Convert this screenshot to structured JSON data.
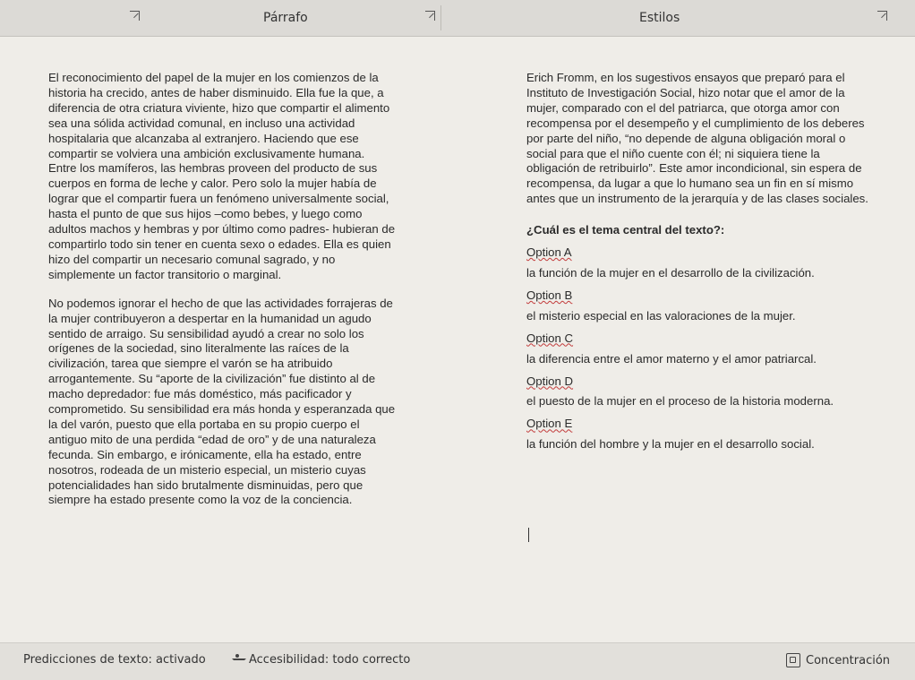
{
  "ribbon": {
    "group_paragraph": "Párrafo",
    "group_styles": "Estilos"
  },
  "document": {
    "left": {
      "para1": "El reconocimiento del papel de la mujer en los comienzos de la historia ha crecido, antes de haber disminuido. Ella fue la que, a diferencia de otra criatura viviente, hizo que compartir el alimento sea una sólida actividad comunal, en incluso una actividad hospitalaria que alcanzaba al extranjero. Haciendo que ese compartir se volviera una ambición exclusivamente humana. Entre los mamíferos, las hembras proveen del producto de sus cuerpos en forma de leche y calor. Pero solo la mujer había de lograr que el compartir fuera un fenómeno universalmente social, hasta el punto de que sus hijos –como bebes, y luego como adultos machos y hembras y por último como padres- hubieran de compartirlo todo sin tener en cuenta sexo o edades. Ella es quien hizo del compartir un necesario comunal sagrado, y no simplemente un factor transitorio o marginal.",
      "para2": "No podemos ignorar el hecho de que las actividades forrajeras de la mujer contribuyeron a despertar en la humanidad un agudo sentido de arraigo. Su sensibilidad ayudó a crear no solo los orígenes de la sociedad, sino literalmente las raíces de la civilización, tarea que siempre el varón se ha atribuido arrogantemente. Su “aporte de la civilización” fue distinto al de macho depredador: fue más doméstico, más pacificador y comprometido. Su sensibilidad era más honda y esperanzada que la del varón, puesto que ella portaba en su propio cuerpo el antiguo mito de una perdida “edad de oro” y de una naturaleza fecunda. Sin embargo, e irónicamente, ella ha estado, entre nosotros, rodeada de un misterio especial, un misterio cuyas potencialidades han sido brutalmente disminuidas, pero que siempre ha estado presente como la voz de la conciencia."
    },
    "right": {
      "para1": "Erich Fromm, en los sugestivos ensayos que preparó para el Instituto de Investigación Social, hizo notar que el amor de la mujer, comparado con el del patriarca, que otorga amor con recompensa por el desempeño y el cumplimiento de los deberes por parte del niño, “no depende de alguna obligación moral o social para que el niño cuente con él; ni siquiera tiene la obligación de retribuirlo”. Este amor incondicional, sin espera de recompensa, da lugar a que lo humano sea un fin en sí mismo antes que un instrumento de la jerarquía y de las clases sociales.",
      "question": "¿Cuál es el tema central del texto?:",
      "options": [
        {
          "label": "Option A",
          "text": "la función de la mujer en el desarrollo de la civilización."
        },
        {
          "label": "Option B",
          "text": "el misterio especial en las valoraciones de la mujer."
        },
        {
          "label": "Option C",
          "text": "la diferencia entre el amor materno y el amor patriarcal."
        },
        {
          "label": "Option D",
          "text": "el puesto de la mujer en el proceso de la historia moderna."
        },
        {
          "label": "Option E",
          "text": "la función del hombre y la mujer en el desarrollo social."
        }
      ]
    }
  },
  "status": {
    "predictions": "Predicciones de texto: activado",
    "accessibility": "Accesibilidad: todo correcto",
    "focus": "Concentración"
  }
}
